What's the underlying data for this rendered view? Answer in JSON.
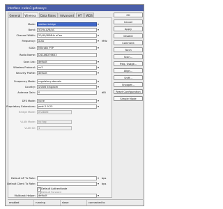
{
  "window": {
    "title": "Interface <wlan1-gateway>"
  },
  "tabs": [
    "General",
    "Wireless",
    "Data Rates",
    "Advanced",
    "HT",
    "WDS"
  ],
  "fields": {
    "mode": {
      "label": "Mode:",
      "value": "station bridge"
    },
    "band": {
      "label": "Band:",
      "value": "5GHz-A/N/AC"
    },
    "channel_width": {
      "label": "Channel Width:",
      "value": "20/40/80MHz eCee"
    },
    "frequency": {
      "label": "Frequency:",
      "value": "auto",
      "unit": "MHz"
    },
    "ssid": {
      "label": "SSID:",
      "value": "Mikrotik PTP"
    },
    "radio_name": {
      "label": "Radio Name:",
      "value": "D4CA6D76633"
    },
    "scan_list": {
      "label": "Scan List:",
      "value": "default"
    },
    "wireless_protocol": {
      "label": "Wireless Protocol:",
      "value": "nv2"
    },
    "security_profile": {
      "label": "Security Profile:",
      "value": "default"
    },
    "frequency_mode": {
      "label": "Frequency Mode:",
      "value": "regulatory-domain"
    },
    "country": {
      "label": "Country:",
      "value": "united kingdom"
    },
    "antenna_gain": {
      "label": "Antenna Gain:",
      "value": "0",
      "unit": "dBi"
    },
    "dfs_mode": {
      "label": "DFS Mode:",
      "value": "none"
    },
    "proprietary_extensions": {
      "label": "Proprietary Extensions:",
      "value": "post-2.9.25"
    },
    "bridge_mode": {
      "label": "Bridge Mode:",
      "value": "enabled"
    },
    "vlan_mode": {
      "label": "VLAN Mode:",
      "value": "no tag"
    },
    "vlan_id": {
      "label": "VLAN ID:",
      "value": "1"
    },
    "default_ap_tx_rate": {
      "label": "Default AP Tx Rate:",
      "value": "",
      "unit": "bps"
    },
    "default_client_tx_rate": {
      "label": "Default Client Tx Rate:",
      "value": "",
      "unit": "bps"
    },
    "multicast_helper": {
      "label": "Multicast Helper:",
      "value": "default"
    }
  },
  "checkboxes": {
    "default_authenticate": {
      "label": "Default Authenticate",
      "checked": true
    },
    "default_forward": {
      "label": "Default Forward",
      "checked": true
    }
  },
  "buttons": [
    "OK",
    "Cancel",
    "Apply",
    "Disable",
    "Comment",
    "Torch",
    "Scan...",
    "Freq. Usage...",
    "Align...",
    "Sniff...",
    "Snooper...",
    "Reset Configuration",
    "Simple Mode"
  ],
  "status_bar": [
    "enabled",
    "running",
    "slave",
    "connected to"
  ]
}
